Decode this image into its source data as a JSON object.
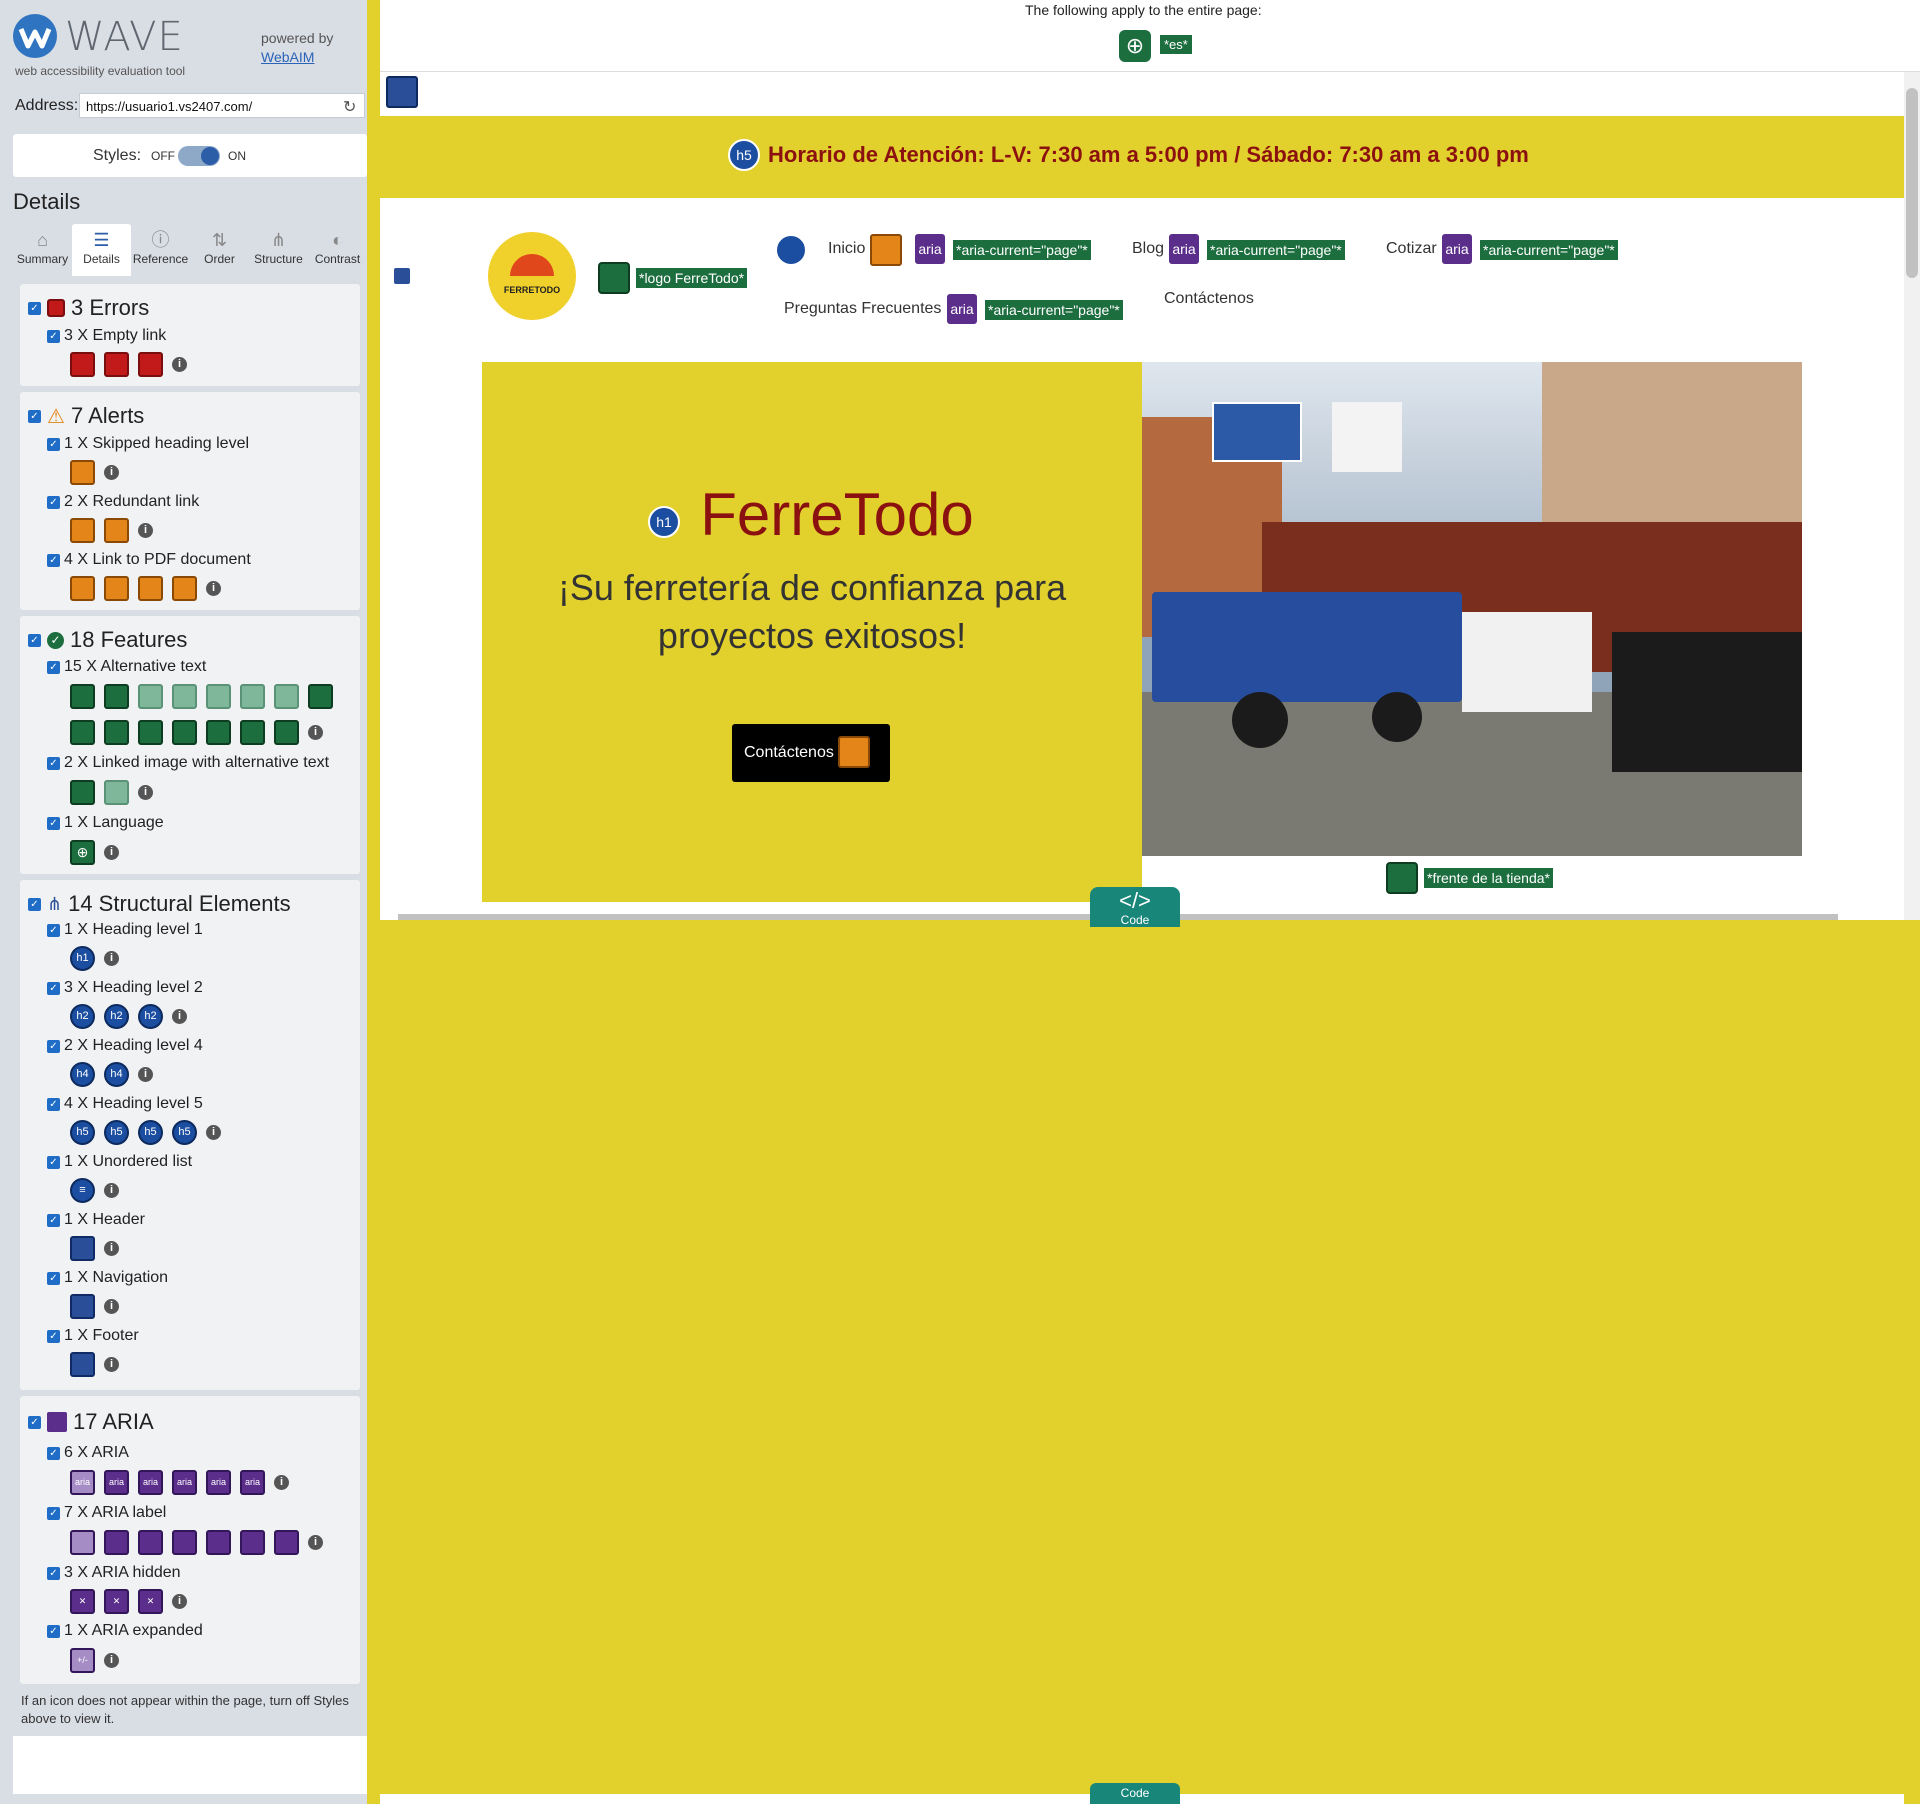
{
  "wave": {
    "title": "WAVE",
    "subtitle": "web accessibility evaluation tool",
    "powered_by": "powered by",
    "webaim": "WebAIM",
    "address_label": "Address:",
    "address_value": "https://usuario1.vs2407.com/",
    "styles_label": "Styles:",
    "styles_off": "OFF",
    "styles_on": "ON",
    "details_title": "Details",
    "tabs": [
      {
        "label": "Summary",
        "icon": "home-icon"
      },
      {
        "label": "Details",
        "icon": "list-icon"
      },
      {
        "label": "Reference",
        "icon": "info-icon"
      },
      {
        "label": "Order",
        "icon": "order-icon"
      },
      {
        "label": "Structure",
        "icon": "structure-icon"
      },
      {
        "label": "Contrast",
        "icon": "contrast-icon"
      }
    ],
    "errors": {
      "title": "3 Errors",
      "items": [
        {
          "label": "3 X Empty link"
        }
      ]
    },
    "alerts": {
      "title": "7 Alerts",
      "items": [
        {
          "label": "1 X Skipped heading level"
        },
        {
          "label": "2 X Redundant link"
        },
        {
          "label": "4 X Link to PDF document"
        }
      ]
    },
    "features": {
      "title": "18 Features",
      "items": [
        {
          "label": "15 X Alternative text"
        },
        {
          "label": "2 X Linked image with alternative text"
        },
        {
          "label": "1 X Language"
        }
      ]
    },
    "structure": {
      "title": "14 Structural Elements",
      "items": [
        {
          "label": "1 X Heading level 1",
          "badge": "h1"
        },
        {
          "label": "3 X Heading level 2",
          "badge": "h2"
        },
        {
          "label": "2 X Heading level 4",
          "badge": "h4"
        },
        {
          "label": "4 X Heading level 5",
          "badge": "h5"
        },
        {
          "label": "1 X Unordered list"
        },
        {
          "label": "1 X Header"
        },
        {
          "label": "1 X Navigation"
        },
        {
          "label": "1 X Footer"
        }
      ]
    },
    "aria": {
      "title": "17 ARIA",
      "items": [
        {
          "label": "6 X ARIA",
          "badge": "aria"
        },
        {
          "label": "7 X ARIA label"
        },
        {
          "label": "3 X ARIA hidden"
        },
        {
          "label": "1 X ARIA expanded"
        }
      ]
    },
    "note": "If an icon does not appear within the page, turn off Styles above to view it."
  },
  "page_top": {
    "text": "The following apply to the entire page:",
    "lang_label": "*es*"
  },
  "site": {
    "banner_badge": "h5",
    "banner": "Horario de Atención: L-V: 7:30 am a 5:00 pm / Sábado: 7:30 am a 3:00 pm",
    "logo_text": "FERRETODO",
    "logo_alt": "*logo FerreTodo*",
    "nav": [
      {
        "label": "Inicio",
        "aria": "*aria-current=\"page\"*"
      },
      {
        "label": "Blog",
        "aria": "*aria-current=\"page\"*"
      },
      {
        "label": "Cotizar",
        "aria": "*aria-current=\"page\"*"
      },
      {
        "label": "Preguntas Frecuentes",
        "aria": "*aria-current=\"page\"*"
      },
      {
        "label": "Contáctenos"
      }
    ],
    "aria_badge": "aria",
    "hero_badge": "h1",
    "hero_title": "FerreTodo",
    "hero_subtitle": "¡Su ferretería de confianza para proyectos exitosos!",
    "hero_button": "Contáctenos",
    "photo_alt": "*frente de la tienda*",
    "code_tab": "Code"
  },
  "colors": {
    "accent": "#e2d12c",
    "brand_red": "#8b1111",
    "wave_blue": "#2f74c0"
  }
}
